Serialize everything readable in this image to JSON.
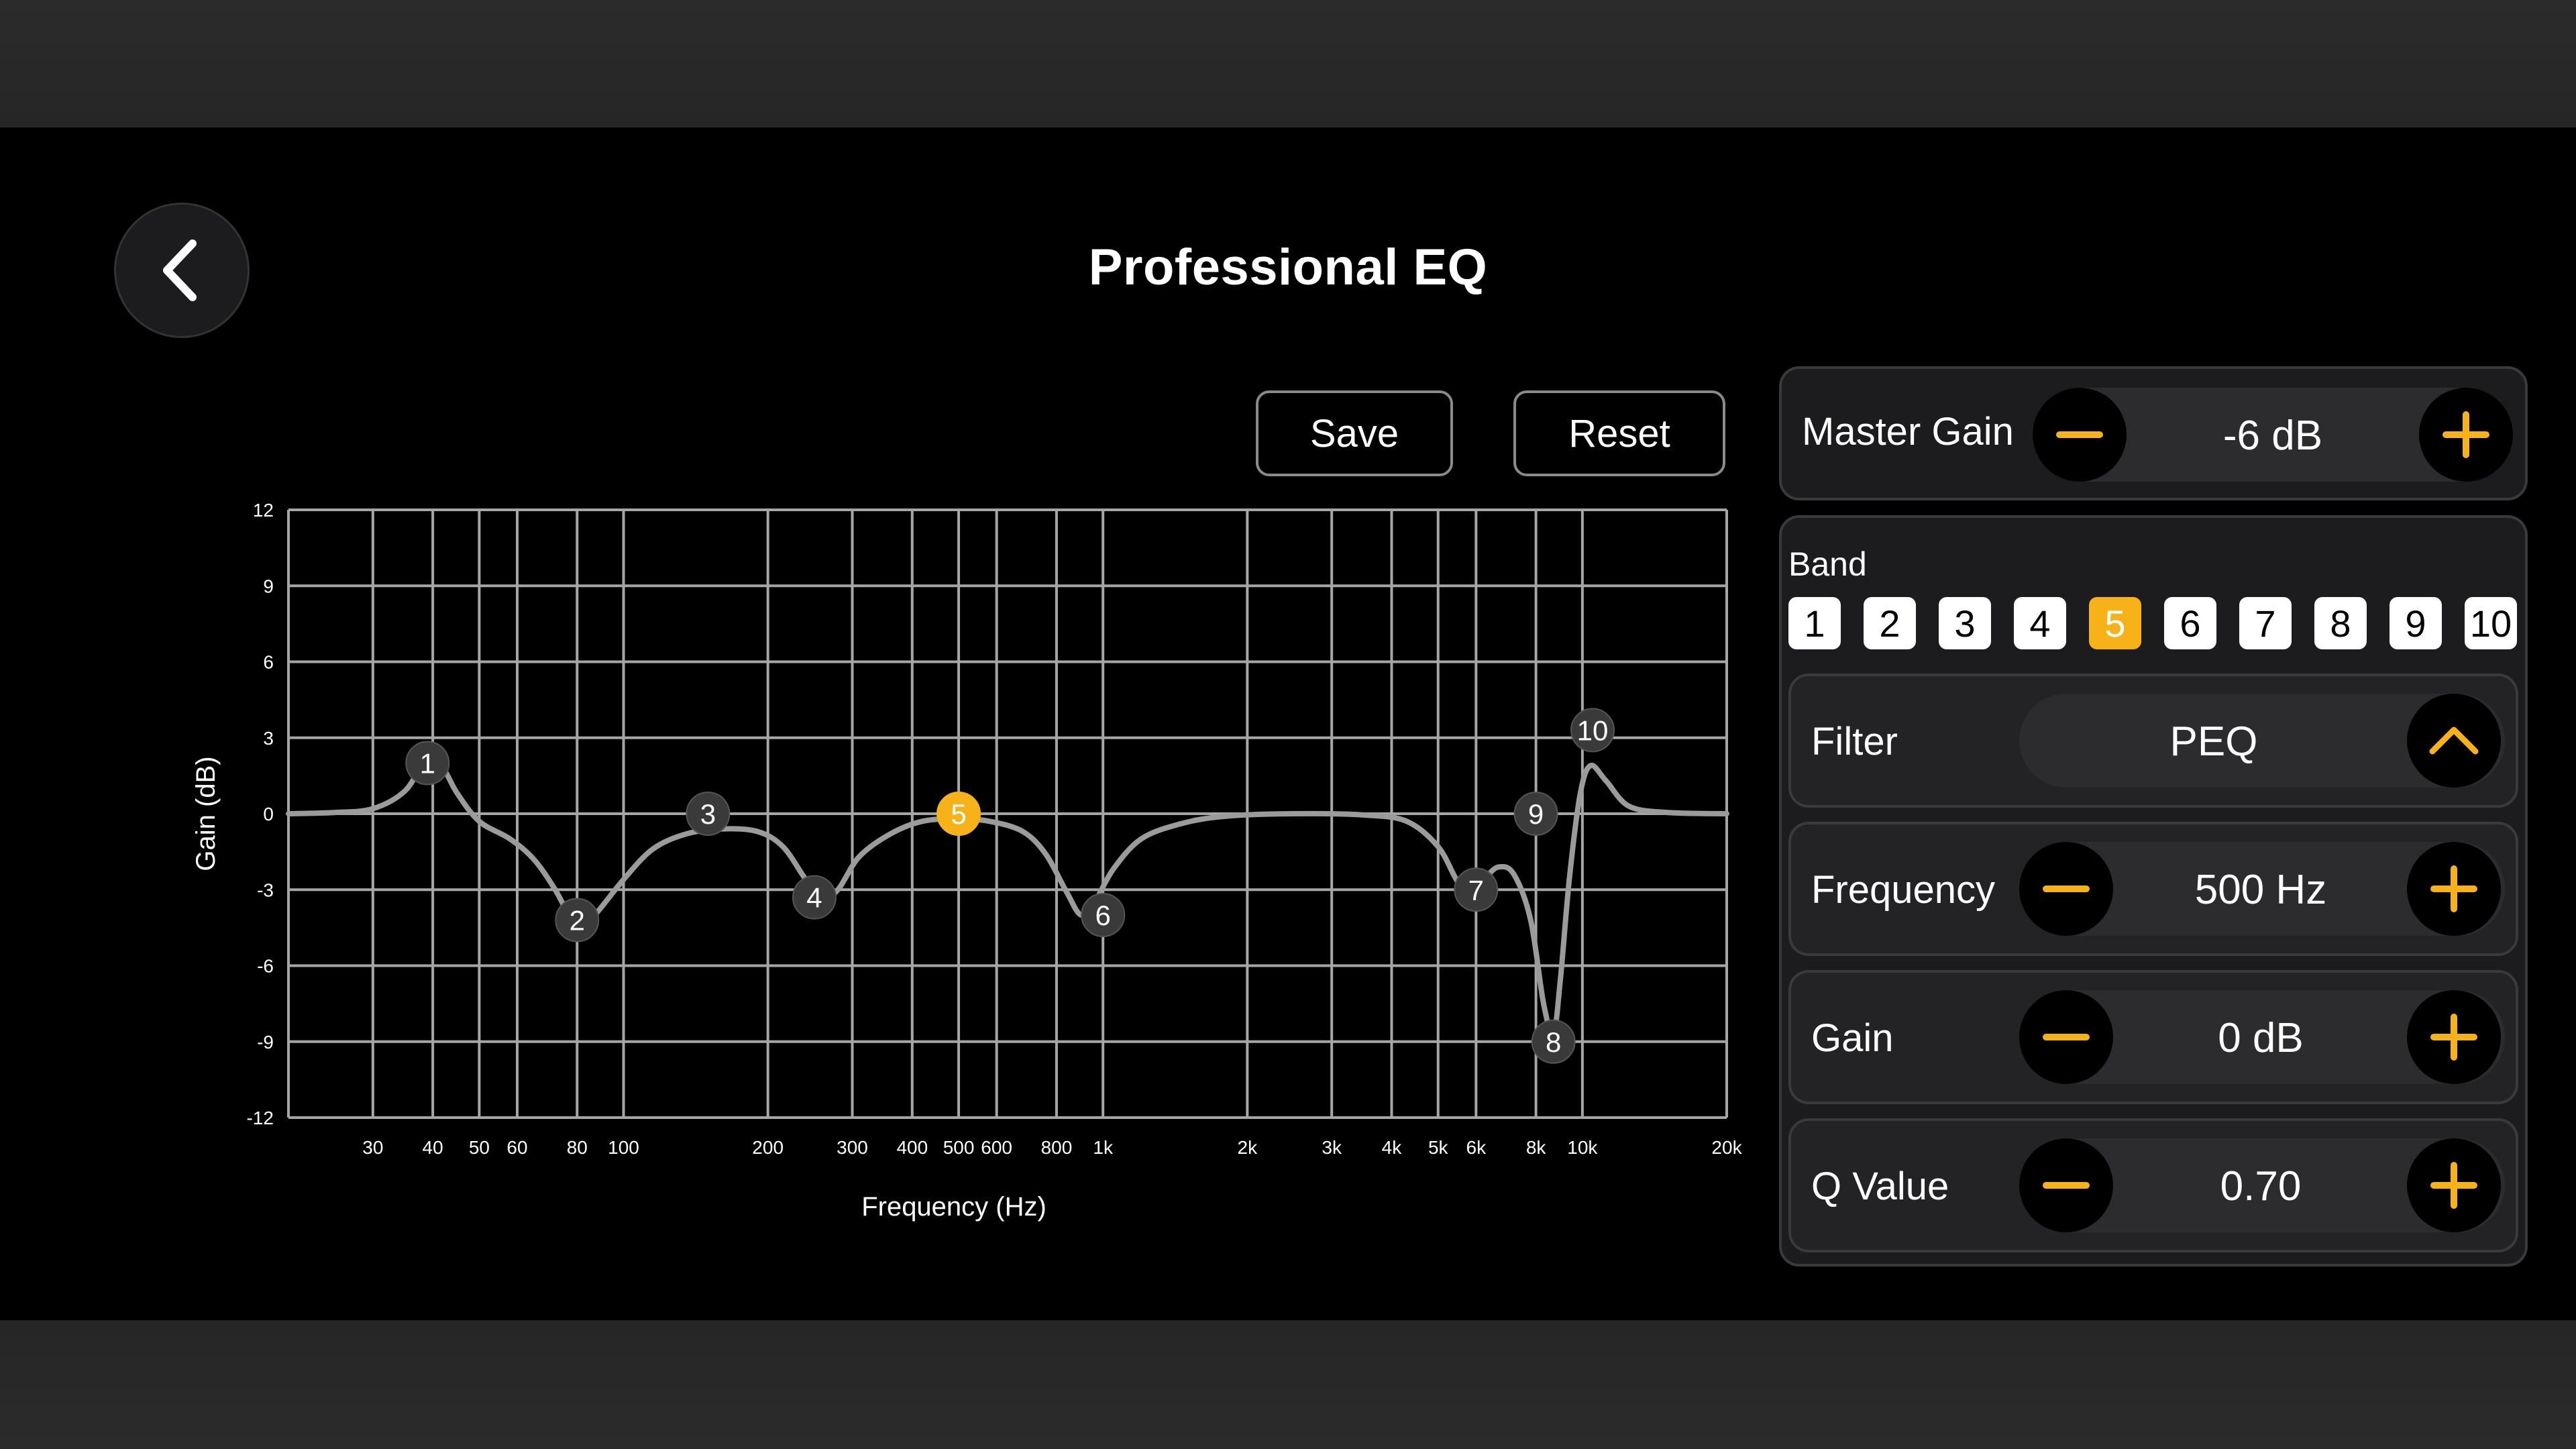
{
  "page": {
    "title": "Professional EQ"
  },
  "actions": {
    "back_icon": "chevron-left-icon",
    "save_label": "Save",
    "reset_label": "Reset"
  },
  "master_gain": {
    "label": "Master Gain",
    "value": "-6 dB",
    "minus_icon": "minus-icon",
    "plus_icon": "plus-icon"
  },
  "band": {
    "label": "Band",
    "items": [
      "1",
      "2",
      "3",
      "4",
      "5",
      "6",
      "7",
      "8",
      "9",
      "10"
    ],
    "selected": "5"
  },
  "filter": {
    "label": "Filter",
    "value": "PEQ",
    "toggle_icon": "chevron-up-icon"
  },
  "frequency": {
    "label": "Frequency",
    "value": "500 Hz"
  },
  "gain": {
    "label": "Gain",
    "value": "0 dB"
  },
  "q_value": {
    "label": "Q Value",
    "value": "0.70"
  },
  "colors": {
    "accent": "#f7b21a",
    "grid": "#a6a6a6",
    "curve": "#9b9b9b",
    "node": "#3a3a3a"
  },
  "chart_data": {
    "type": "line",
    "xlabel": "Frequency (Hz)",
    "ylabel": "Gain (dB)",
    "x_scale": "log",
    "xlim": [
      20,
      20000
    ],
    "ylim": [
      -12,
      12
    ],
    "grid": true,
    "y_ticks": [
      "12",
      "9",
      "6",
      "3",
      "0",
      "-3",
      "-6",
      "-9",
      "-12"
    ],
    "x_ticks": [
      {
        "f": 30,
        "label": "30"
      },
      {
        "f": 40,
        "label": "40"
      },
      {
        "f": 50,
        "label": "50"
      },
      {
        "f": 60,
        "label": "60"
      },
      {
        "f": 80,
        "label": "80"
      },
      {
        "f": 100,
        "label": "100"
      },
      {
        "f": 200,
        "label": "200"
      },
      {
        "f": 300,
        "label": "300"
      },
      {
        "f": 400,
        "label": "400"
      },
      {
        "f": 500,
        "label": "500"
      },
      {
        "f": 600,
        "label": "600"
      },
      {
        "f": 800,
        "label": "800"
      },
      {
        "f": 1000,
        "label": "1k"
      },
      {
        "f": 2000,
        "label": "2k"
      },
      {
        "f": 3000,
        "label": "3k"
      },
      {
        "f": 4000,
        "label": "4k"
      },
      {
        "f": 5000,
        "label": "5k"
      },
      {
        "f": 6000,
        "label": "6k"
      },
      {
        "f": 8000,
        "label": "8k"
      },
      {
        "f": 10000,
        "label": "10k"
      },
      {
        "f": 20000,
        "label": "20k"
      }
    ],
    "curve": [
      [
        20,
        0
      ],
      [
        25,
        0.05
      ],
      [
        30,
        0.2
      ],
      [
        35,
        0.9
      ],
      [
        39,
        2.2
      ],
      [
        42,
        1.8
      ],
      [
        45,
        0.8
      ],
      [
        50,
        -0.3
      ],
      [
        58,
        -1.0
      ],
      [
        65,
        -1.8
      ],
      [
        72,
        -3.0
      ],
      [
        78,
        -4.2
      ],
      [
        82,
        -4.4
      ],
      [
        88,
        -3.9
      ],
      [
        100,
        -2.6
      ],
      [
        115,
        -1.4
      ],
      [
        135,
        -0.8
      ],
      [
        160,
        -0.6
      ],
      [
        190,
        -0.7
      ],
      [
        215,
        -1.3
      ],
      [
        240,
        -2.6
      ],
      [
        260,
        -3.3
      ],
      [
        280,
        -3.0
      ],
      [
        310,
        -1.7
      ],
      [
        360,
        -0.8
      ],
      [
        420,
        -0.3
      ],
      [
        500,
        -0.2
      ],
      [
        580,
        -0.3
      ],
      [
        680,
        -0.7
      ],
      [
        760,
        -1.6
      ],
      [
        840,
        -3.1
      ],
      [
        900,
        -4.0
      ],
      [
        960,
        -3.5
      ],
      [
        1050,
        -2.2
      ],
      [
        1200,
        -1.0
      ],
      [
        1450,
        -0.4
      ],
      [
        1800,
        -0.1
      ],
      [
        2500,
        0
      ],
      [
        3500,
        -0.05
      ],
      [
        4300,
        -0.3
      ],
      [
        5000,
        -1.3
      ],
      [
        5500,
        -2.7
      ],
      [
        5900,
        -3.2
      ],
      [
        6300,
        -2.5
      ],
      [
        6700,
        -2.1
      ],
      [
        7200,
        -2.4
      ],
      [
        7800,
        -4.2
      ],
      [
        8300,
        -7.5
      ],
      [
        8700,
        -8.7
      ],
      [
        9000,
        -6.5
      ],
      [
        9400,
        -2.5
      ],
      [
        9900,
        0.8
      ],
      [
        10400,
        1.9
      ],
      [
        11200,
        1.3
      ],
      [
        12500,
        0.3
      ],
      [
        15000,
        0.05
      ],
      [
        20000,
        0
      ]
    ],
    "bands": [
      {
        "label": "1",
        "freq": 39,
        "gain": 2
      },
      {
        "label": "2",
        "freq": 80,
        "gain": -4.2
      },
      {
        "label": "3",
        "freq": 150,
        "gain": 0
      },
      {
        "label": "4",
        "freq": 250,
        "gain": -3.3
      },
      {
        "label": "5",
        "freq": 500,
        "gain": 0
      },
      {
        "label": "6",
        "freq": 1000,
        "gain": -4
      },
      {
        "label": "7",
        "freq": 6000,
        "gain": -3
      },
      {
        "label": "8",
        "freq": 8700,
        "gain": -9
      },
      {
        "label": "9",
        "freq": 8000,
        "gain": 0
      },
      {
        "label": "10",
        "freq": 10500,
        "gain": 3.3
      }
    ]
  }
}
